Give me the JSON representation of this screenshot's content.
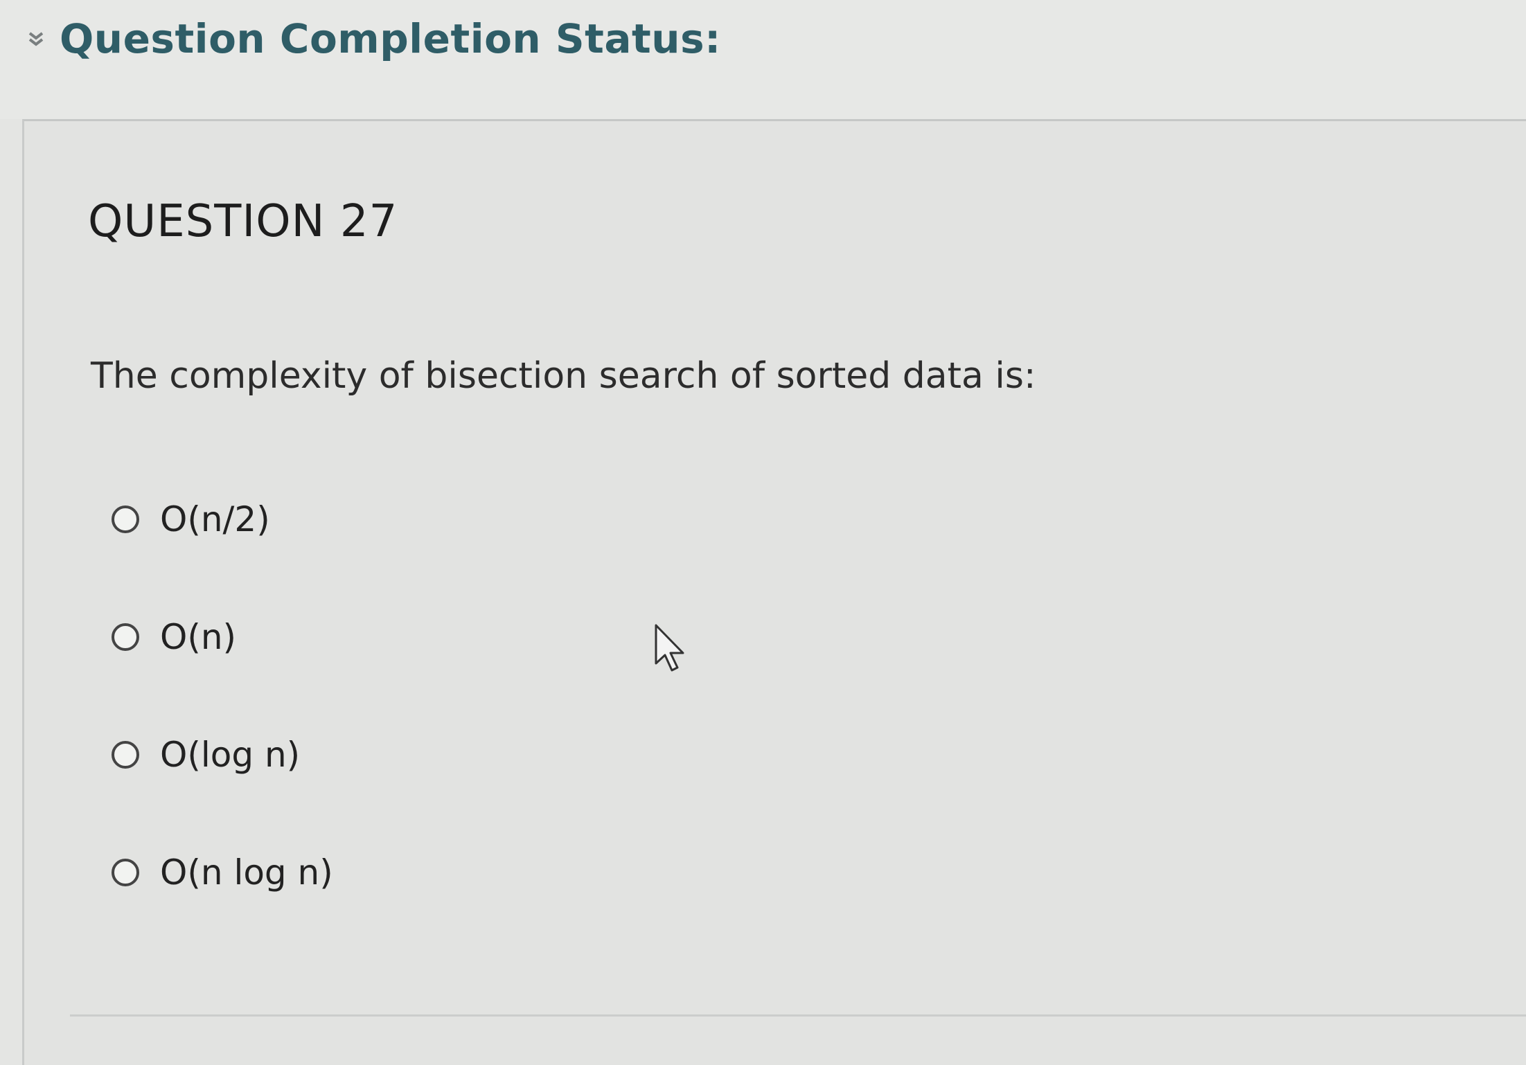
{
  "status_bar": {
    "title": "Question Completion Status:",
    "icon": "chevron-down-icon"
  },
  "question": {
    "heading": "QUESTION 27",
    "text": "The complexity of bisection search of sorted data is:",
    "choices": [
      {
        "label": "O(n/2)",
        "selected": false
      },
      {
        "label": "O(n)",
        "selected": false
      },
      {
        "label": "O(log n)",
        "selected": false
      },
      {
        "label": "O(n log n)",
        "selected": false
      }
    ]
  },
  "colors": {
    "status_title": "#2f5d67",
    "background": "#e4e5e3"
  }
}
